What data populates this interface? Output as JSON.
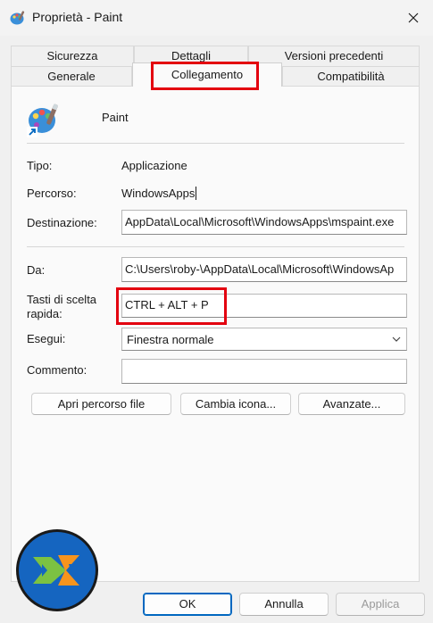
{
  "window": {
    "title": "Proprietà - Paint"
  },
  "tabs": {
    "row1": [
      "Sicurezza",
      "Dettagli",
      "Versioni precedenti"
    ],
    "row2": [
      "Generale",
      "Collegamento",
      "Compatibilità"
    ],
    "active": "Collegamento"
  },
  "app": {
    "name": "Paint"
  },
  "fields": {
    "tipo_label": "Tipo:",
    "tipo_value": "Applicazione",
    "percorso_label": "Percorso:",
    "percorso_value": "WindowsApps",
    "destinazione_label": "Destinazione:",
    "destinazione_value": "AppData\\Local\\Microsoft\\WindowsApps\\mspaint.exe",
    "da_label": "Da:",
    "da_value": "C:\\Users\\roby-\\AppData\\Local\\Microsoft\\WindowsAp",
    "tasti_label_1": "Tasti di scelta",
    "tasti_label_2": "rapida:",
    "tasti_value": "CTRL + ALT + P",
    "esegui_label": "Esegui:",
    "esegui_value": "Finestra normale",
    "commento_label": "Commento:",
    "commento_value": ""
  },
  "buttons": {
    "apri": "Apri percorso file",
    "cambia": "Cambia icona...",
    "avanzate": "Avanzate...",
    "ok": "OK",
    "annulla": "Annulla",
    "applica": "Applica"
  },
  "colors": {
    "highlight": "#e3000f",
    "logo_blue": "#1565c0",
    "logo_green": "#7cc242",
    "logo_orange": "#f7941d"
  },
  "icons": [
    "paint-app-icon",
    "close-icon",
    "chevron-down-icon",
    "shortcut-arrow-icon"
  ]
}
